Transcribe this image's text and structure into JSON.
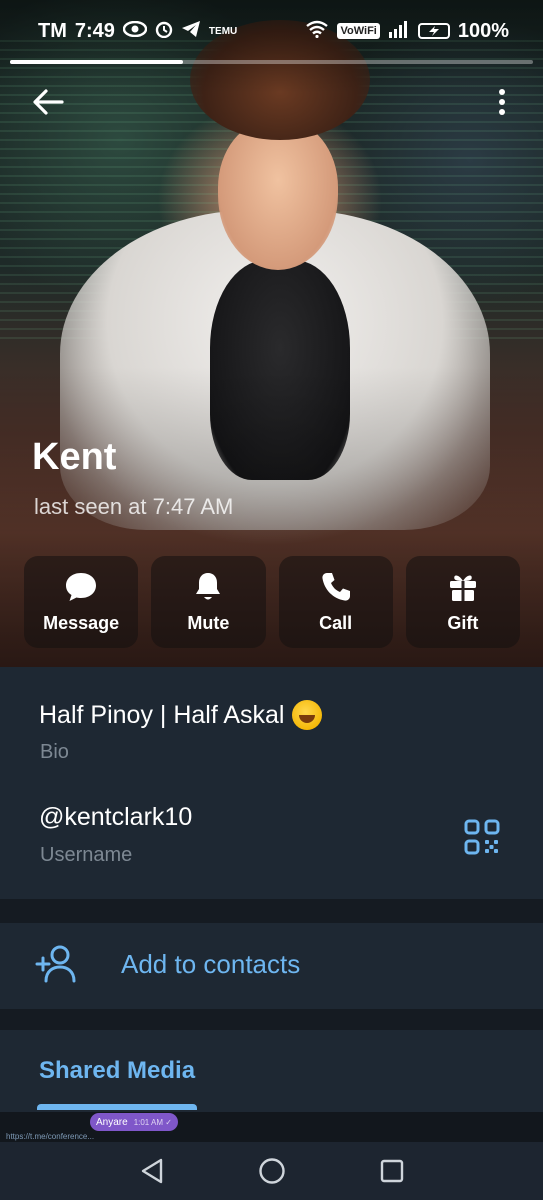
{
  "status_bar": {
    "carrier": "TM",
    "time": "7:49",
    "temu_label": "TEMU",
    "vowifi_label": "VoWiFi",
    "battery_percent": "100%"
  },
  "story_progress": 0.33,
  "profile": {
    "name": "Kent",
    "last_seen": "last seen at 7:47 AM"
  },
  "actions": [
    {
      "label": "Message",
      "icon": "message-bubble-icon"
    },
    {
      "label": "Mute",
      "icon": "bell-icon"
    },
    {
      "label": "Call",
      "icon": "phone-icon"
    },
    {
      "label": "Gift",
      "icon": "gift-icon"
    }
  ],
  "info": {
    "bio_text": "Half Pinoy | Half Askal",
    "bio_emoji": "rolling-on-floor-laughing",
    "bio_label": "Bio",
    "username": "@kentclark10",
    "username_label": "Username"
  },
  "add_contact": {
    "label": "Add to contacts"
  },
  "shared_media": {
    "tab_label": "Shared Media"
  },
  "preview": {
    "bubble_text": "Anyare",
    "bubble_time": "1:01 AM ✓",
    "link_text": "https://t.me/conference..."
  },
  "colors": {
    "accent": "#6eb6f0",
    "panel": "#1e2833",
    "divider": "#151b22",
    "muted_text": "#7d8893"
  }
}
